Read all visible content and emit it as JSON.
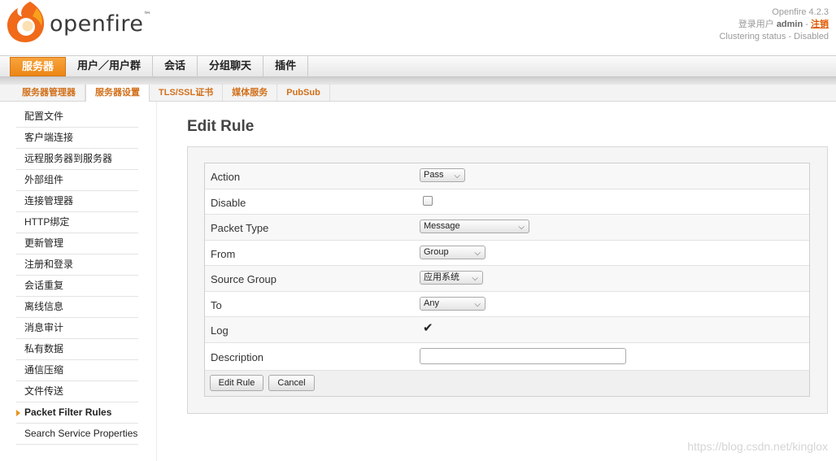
{
  "header": {
    "logo_text": "openfire",
    "logo_tm": "™",
    "version": "Openfire 4.2.3",
    "login_prefix": "登录用户",
    "user": "admin",
    "separator": " - ",
    "logout": "注销",
    "clustering": "Clustering status - Disabled"
  },
  "main_tabs": [
    "服务器",
    "用户／用户群",
    "会话",
    "分组聊天",
    "插件"
  ],
  "sub_tabs": [
    "服务器管理器",
    "服务器设置",
    "TLS/SSL证书",
    "媒体服务",
    "PubSub"
  ],
  "sidebar": [
    "配置文件",
    "客户端连接",
    "远程服务器到服务器",
    "外部组件",
    "连接管理器",
    "HTTP绑定",
    "更新管理",
    "注册和登录",
    "会话重复",
    "离线信息",
    "消息审计",
    "私有数据",
    "通信压缩",
    "文件传送",
    "Packet Filter Rules",
    "Search Service Properties"
  ],
  "page": {
    "title": "Edit Rule",
    "fields": {
      "action_label": "Action",
      "action_value": "Pass",
      "disable_label": "Disable",
      "packet_type_label": "Packet Type",
      "packet_type_value": "Message",
      "from_label": "From",
      "from_value": "Group",
      "source_group_label": "Source Group",
      "source_group_value": "应用系统",
      "to_label": "To",
      "to_value": "Any",
      "log_label": "Log",
      "description_label": "Description",
      "description_value": ""
    },
    "disable_checked": false,
    "log_checked": true,
    "buttons": {
      "edit_rule": "Edit Rule",
      "cancel": "Cancel"
    }
  },
  "watermark": "https://blog.csdn.net/kinglox",
  "colors": {
    "accent": "#ec8613",
    "subtab_text": "#d2701a"
  }
}
